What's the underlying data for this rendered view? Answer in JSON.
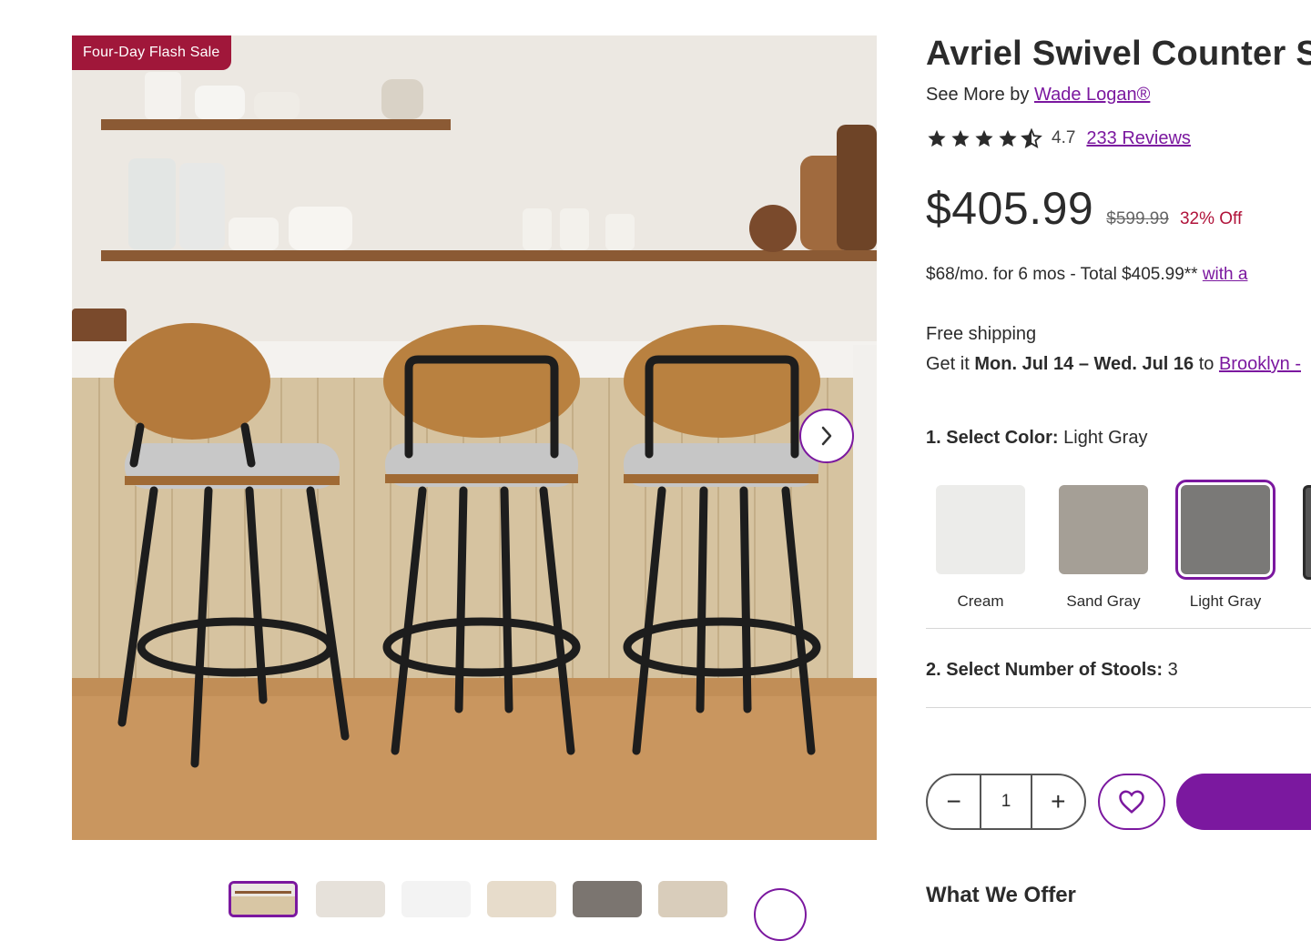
{
  "gallery": {
    "badge": "Four-Day Flash Sale",
    "main_image": "three-counter-stools-kitchen-photo",
    "next_icon": "chevron-right-icon",
    "thumbnail_count": 6,
    "active_thumbnail": 1
  },
  "product": {
    "title": "Avriel Swivel Counter S",
    "see_more_prefix": "See More by ",
    "brand": "Wade Logan®",
    "rating_value": "4.7",
    "rating_stars": 4.7,
    "reviews_link": "233 Reviews",
    "price": "$405.99",
    "old_price": "$599.99",
    "discount": "32% Off",
    "finance_text": "$68/mo. for 6 mos - Total $405.99** ",
    "finance_link": "with a",
    "free_shipping": "Free shipping",
    "delivery_prefix": "Get it ",
    "delivery_dates": "Mon. Jul 14 – Wed. Jul 16",
    "delivery_to": " to ",
    "delivery_location": "Brooklyn -"
  },
  "color_select": {
    "label": "1. Select Color:",
    "value": "Light Gray",
    "options": [
      {
        "name": "Cream",
        "color": "#ececea"
      },
      {
        "name": "Sand Gray",
        "color": "#a59f96"
      },
      {
        "name": "Light Gray",
        "color": "#7a7977"
      }
    ],
    "selected_index": 2
  },
  "stools_select": {
    "label": "2. Select Number of Stools:",
    "value": "3"
  },
  "quantity": {
    "value": "1",
    "minus": "−",
    "plus": "+"
  },
  "section_heading": "What We Offer",
  "colors": {
    "accent": "#7b189f",
    "sale": "#a0173a",
    "discount": "#b0133a"
  }
}
